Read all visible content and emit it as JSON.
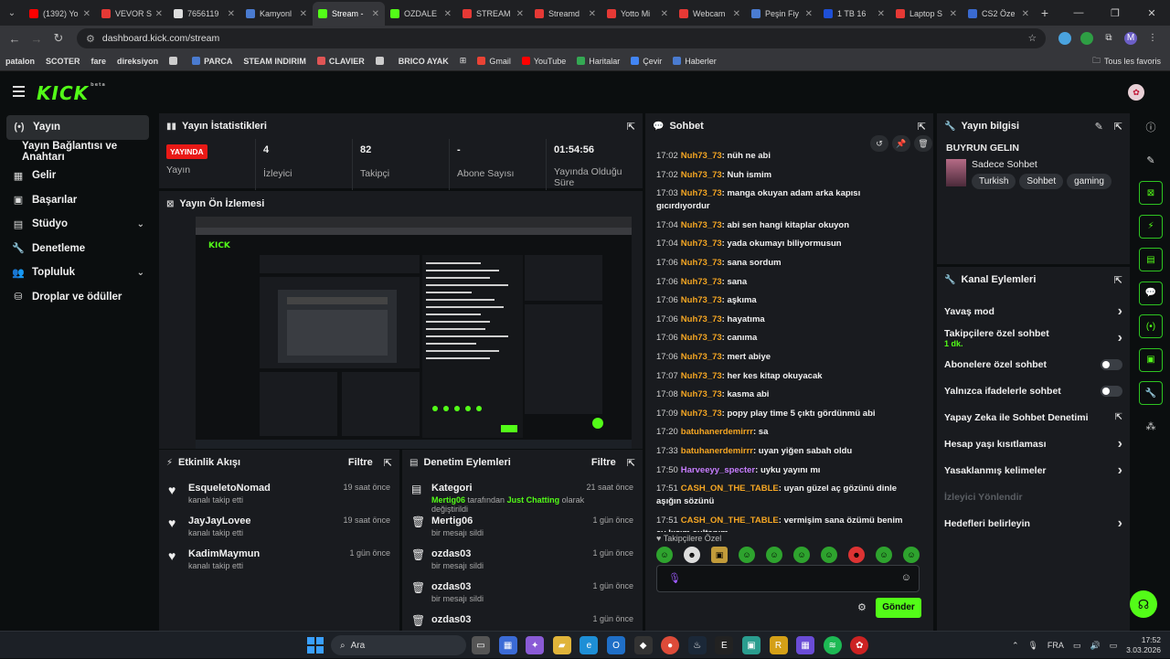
{
  "browser": {
    "tabs": [
      {
        "title": "(1392) Yo",
        "color": "#ff0000"
      },
      {
        "title": "VEVOR S",
        "color": "#e53935"
      },
      {
        "title": "7656119",
        "color": "#dddddd"
      },
      {
        "title": "Kamyonl",
        "color": "#4a7bd0"
      },
      {
        "title": "Stream -",
        "color": "#53fc18"
      },
      {
        "title": "OZDALE",
        "color": "#53fc18"
      },
      {
        "title": "STREAM",
        "color": "#e53935"
      },
      {
        "title": "Streamd",
        "color": "#e53935"
      },
      {
        "title": "Yotto Mi",
        "color": "#e53935"
      },
      {
        "title": "Webcam",
        "color": "#e53935"
      },
      {
        "title": "Peşin Fiy",
        "color": "#4a7bd0"
      },
      {
        "title": "1 TB 16",
        "color": "#1e4fd6"
      },
      {
        "title": "Laptop S",
        "color": "#e53935"
      },
      {
        "title": "CS2 Öze",
        "color": "#3a6ad0"
      }
    ],
    "new_tab": "+",
    "url": "dashboard.kick.com/stream",
    "bookmarks": [
      {
        "label": "patalon",
        "bold": true,
        "color": ""
      },
      {
        "label": "SCOTER",
        "bold": true,
        "color": ""
      },
      {
        "label": "fare",
        "bold": true,
        "color": ""
      },
      {
        "label": "direksiyon",
        "bold": true,
        "color": ""
      },
      {
        "label": "",
        "bold": true,
        "color": "#cccccc"
      },
      {
        "label": "PARCA",
        "bold": true,
        "color": "#4a7bd0"
      },
      {
        "label": "STEAM INDIRIM",
        "bold": true,
        "color": ""
      },
      {
        "label": "CLAVIER",
        "bold": true,
        "color": "#e05555"
      },
      {
        "label": "",
        "bold": true,
        "color": "#cccccc"
      },
      {
        "label": "BRICO AYAK",
        "bold": true,
        "color": ""
      },
      {
        "label": "Gmail",
        "bold": false,
        "color": "#ea4335"
      },
      {
        "label": "YouTube",
        "bold": false,
        "color": "#ff0000"
      },
      {
        "label": "Haritalar",
        "bold": false,
        "color": "#34a853"
      },
      {
        "label": "Çevir",
        "bold": false,
        "color": "#4285f4"
      },
      {
        "label": "Haberler",
        "bold": false,
        "color": "#4a7bd0"
      }
    ],
    "all_bookmarks": "Tous les favoris",
    "profile_initial": "M"
  },
  "kick": {
    "logo": "KICK",
    "logo_sup": "beta",
    "sidebar": [
      {
        "label": "Yayın",
        "icon": "(•)",
        "active": true,
        "sub": false,
        "chev": false
      },
      {
        "label": "Yayın Bağlantısı ve Anahtarı",
        "icon": "",
        "active": false,
        "sub": true,
        "chev": false
      },
      {
        "label": "Gelir",
        "icon": "▦",
        "active": false,
        "sub": false,
        "chev": false
      },
      {
        "label": "Başarılar",
        "icon": "▣",
        "active": false,
        "sub": false,
        "chev": false
      },
      {
        "label": "Stüdyo",
        "icon": "▤",
        "active": false,
        "sub": false,
        "chev": true
      },
      {
        "label": "Denetleme",
        "icon": "🔧",
        "active": false,
        "sub": false,
        "chev": false
      },
      {
        "label": "Topluluk",
        "icon": "👥",
        "active": false,
        "sub": false,
        "chev": true
      },
      {
        "label": "Droplar ve ödüller",
        "icon": "⛁",
        "active": false,
        "sub": false,
        "chev": false
      }
    ],
    "stats_panel": {
      "title": "Yayın İstatistikleri",
      "badge": "YAYINDA",
      "items": [
        {
          "value": "",
          "label": "Yayın"
        },
        {
          "value": "4",
          "label": "İzleyici"
        },
        {
          "value": "82",
          "label": "Takipçi"
        },
        {
          "value": "-",
          "label": "Abone Sayısı"
        },
        {
          "value": "01:54:56",
          "label": "Yayında Olduğu Süre"
        }
      ]
    },
    "preview_title": "Yayın Ön İzlemesi",
    "activity": {
      "title": "Etkinlik Akışı",
      "filter": "Filtre",
      "items": [
        {
          "name": "EsqueletoNomad",
          "sub": "kanalı takip etti",
          "time": "19 saat önce"
        },
        {
          "name": "JayJayLovee",
          "sub": "kanalı takip etti",
          "time": "19 saat önce"
        },
        {
          "name": "KadimMaymun",
          "sub": "kanalı takip etti",
          "time": "1 gün önce"
        }
      ]
    },
    "moderation": {
      "title": "Denetim Eylemleri",
      "filter": "Filtre",
      "items": [
        {
          "icon": "cat",
          "name": "Kategori",
          "sub_user": "Mertig06",
          "sub_mid": " tarafından ",
          "sub_cat": "Just Chatting",
          "sub_end": " olarak değiştirildi",
          "time": "21 saat önce"
        },
        {
          "icon": "del",
          "name": "Mertig06",
          "sub_user": "",
          "sub_mid": "bir mesajı sildi",
          "sub_cat": "",
          "sub_end": "",
          "time": "1 gün önce"
        },
        {
          "icon": "del",
          "name": "ozdas03",
          "sub_user": "",
          "sub_mid": "bir mesajı sildi",
          "sub_cat": "",
          "sub_end": "",
          "time": "1 gün önce"
        },
        {
          "icon": "del",
          "name": "ozdas03",
          "sub_user": "",
          "sub_mid": "bir mesajı sildi",
          "sub_cat": "",
          "sub_end": "",
          "time": "1 gün önce"
        },
        {
          "icon": "del",
          "name": "ozdas03",
          "sub_user": "",
          "sub_mid": "",
          "sub_cat": "",
          "sub_end": "",
          "time": "1 gün önce"
        }
      ]
    },
    "chat": {
      "title": "Sohbet",
      "messages": [
        {
          "time": "17:02",
          "user": "Nuh73_73",
          "color": "#f5a623",
          "text": "nüh ne abi"
        },
        {
          "time": "17:02",
          "user": "Nuh73_73",
          "color": "#f5a623",
          "text": "Nuh ismim"
        },
        {
          "time": "17:03",
          "user": "Nuh73_73",
          "color": "#f5a623",
          "text": "manga okuyan adam arka kapısı gıcırdıyordur"
        },
        {
          "time": "17:04",
          "user": "Nuh73_73",
          "color": "#f5a623",
          "text": "abi sen hangi kitaplar okuyon"
        },
        {
          "time": "17:04",
          "user": "Nuh73_73",
          "color": "#f5a623",
          "text": "yada okumayı biliyormusun"
        },
        {
          "time": "17:06",
          "user": "Nuh73_73",
          "color": "#f5a623",
          "text": "sana sordum"
        },
        {
          "time": "17:06",
          "user": "Nuh73_73",
          "color": "#f5a623",
          "text": "sana"
        },
        {
          "time": "17:06",
          "user": "Nuh73_73",
          "color": "#f5a623",
          "text": "aşkıma"
        },
        {
          "time": "17:06",
          "user": "Nuh73_73",
          "color": "#f5a623",
          "text": "hayatıma"
        },
        {
          "time": "17:06",
          "user": "Nuh73_73",
          "color": "#f5a623",
          "text": "canıma"
        },
        {
          "time": "17:06",
          "user": "Nuh73_73",
          "color": "#f5a623",
          "text": "mert abiye"
        },
        {
          "time": "17:07",
          "user": "Nuh73_73",
          "color": "#f5a623",
          "text": "her kes kitap okuyacak"
        },
        {
          "time": "17:08",
          "user": "Nuh73_73",
          "color": "#f5a623",
          "text": "kasma abi"
        },
        {
          "time": "17:09",
          "user": "Nuh73_73",
          "color": "#f5a623",
          "text": "popy play time 5 çıktı gördünmü abi"
        },
        {
          "time": "17:20",
          "user": "batuhanerdemirrr",
          "color": "#f5a623",
          "text": "sa"
        },
        {
          "time": "17:33",
          "user": "batuhanerdemirrr",
          "color": "#f5a623",
          "text": "uyan yiğen sabah oldu"
        },
        {
          "time": "17:50",
          "user": "Harveeyy_specter",
          "color": "#c77dff",
          "text": "uyku yayını mı"
        },
        {
          "time": "17:51",
          "user": "CASH_ON_THE_TABLE",
          "color": "#f5a623",
          "text": "uyan güzel aç gözünü dinle aşığın sözünü"
        },
        {
          "time": "17:51",
          "user": "CASH_ON_THE_TABLE",
          "color": "#f5a623",
          "text": "vermişim sana özümü benim ay kızım sultanım"
        }
      ],
      "followers_only": "Takipçilere Özel",
      "send": "Gönder"
    },
    "stream_info": {
      "title": "Yayın bilgisi",
      "stream_title": "BUYRUN GELIN",
      "category": "Sadece Sohbet",
      "tags": [
        "Turkish",
        "Sohbet",
        "gaming"
      ]
    },
    "channel_actions": {
      "title": "Kanal Eylemleri",
      "items": [
        {
          "label": "Yavaş mod",
          "sub": "",
          "kind": "arrow",
          "muted": false
        },
        {
          "label": "Takipçilere özel sohbet",
          "sub": "1 dk.",
          "kind": "arrow",
          "muted": false
        },
        {
          "label": "Abonelere özel sohbet",
          "sub": "",
          "kind": "toggle",
          "muted": false
        },
        {
          "label": "Yalnızca ifadelerle sohbet",
          "sub": "",
          "kind": "toggle",
          "muted": false
        },
        {
          "label": "Yapay Zeka ile Sohbet Denetimi",
          "sub": "",
          "kind": "ext",
          "muted": false
        },
        {
          "label": "Hesap yaşı kısıtlaması",
          "sub": "",
          "kind": "arrow",
          "muted": false
        },
        {
          "label": "Yasaklanmış kelimeler",
          "sub": "",
          "kind": "arrow",
          "muted": false
        },
        {
          "label": "İzleyici Yönlendir",
          "sub": "",
          "kind": "none",
          "muted": true
        },
        {
          "label": "Hedefleri belirleyin",
          "sub": "",
          "kind": "arrow",
          "muted": false
        }
      ]
    }
  },
  "taskbar": {
    "search": "Ara",
    "lang": "FRA",
    "time": "17:52",
    "date": "3.03.2026"
  }
}
